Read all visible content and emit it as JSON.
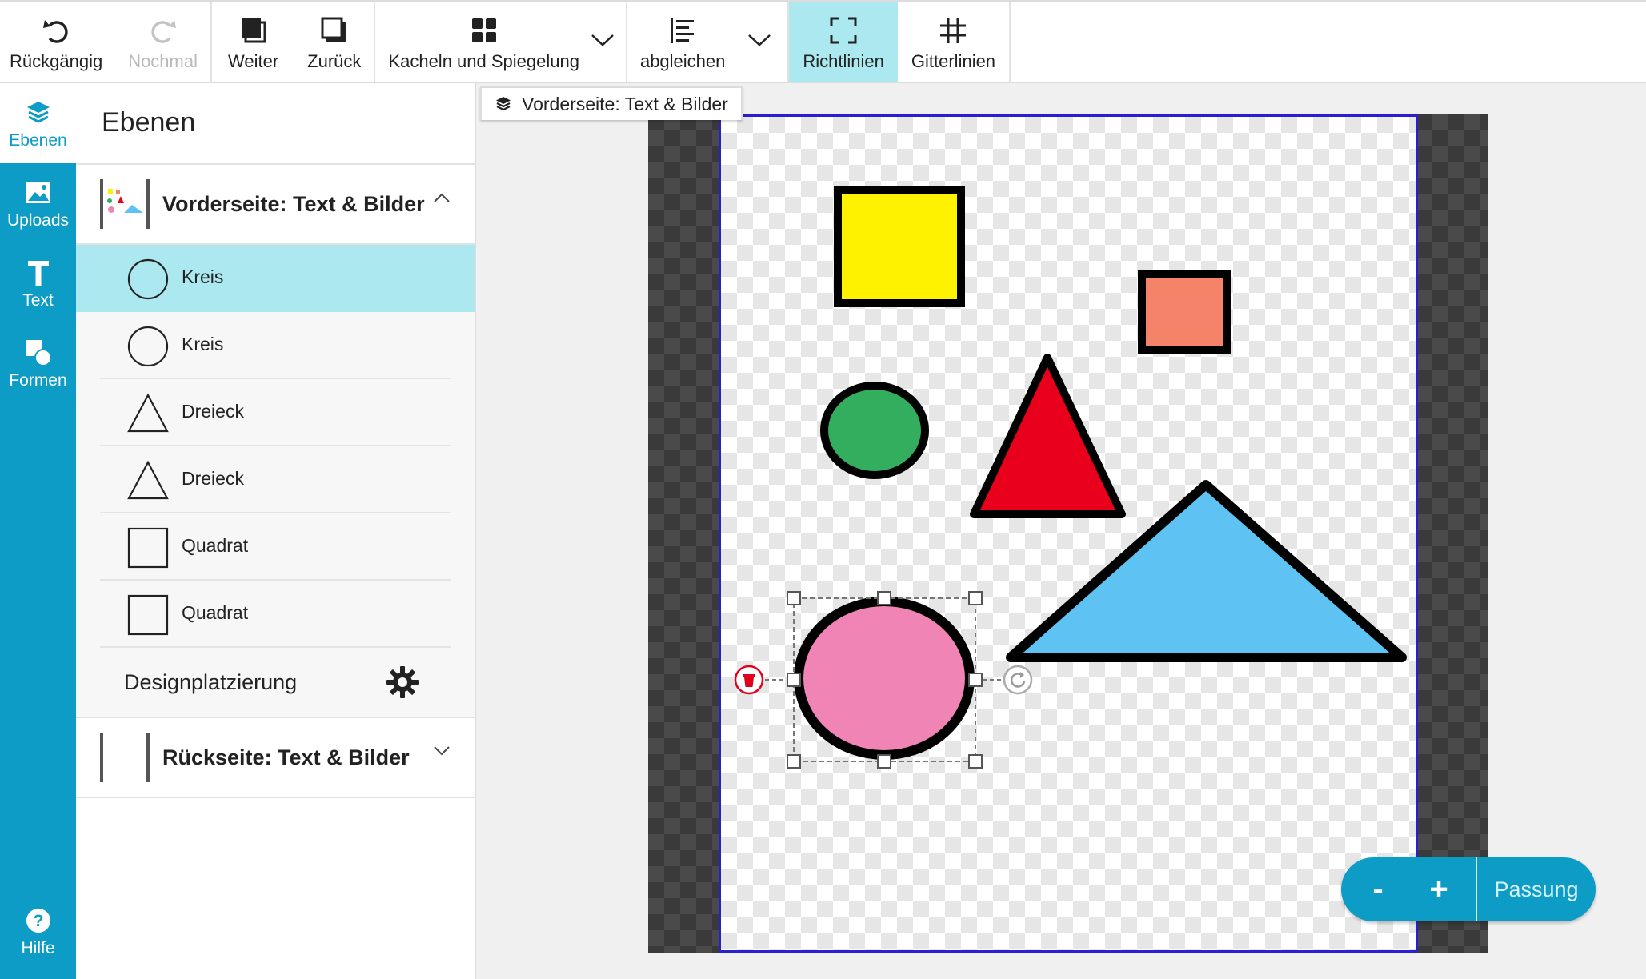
{
  "toolbar": {
    "undo": "Rückgängig",
    "redo": "Nochmal",
    "forward": "Weiter",
    "back": "Zurück",
    "tiles": "Kacheln und Spiegelung",
    "align": "abgleichen",
    "guides": "Richtlinien",
    "grid": "Gitterlinien"
  },
  "nav": {
    "layers": "Ebenen",
    "uploads": "Uploads",
    "text": "Text",
    "shapes": "Formen",
    "help": "Hilfe",
    "active": "layers"
  },
  "panel": {
    "title": "Ebenen",
    "front_group": "Vorderseite: Text & Bilder",
    "back_group": "Rückseite: Text & Bilder",
    "layers": [
      {
        "label": "Kreis",
        "shape": "circle",
        "selected": true
      },
      {
        "label": "Kreis",
        "shape": "circle",
        "selected": false
      },
      {
        "label": "Dreieck",
        "shape": "triangle",
        "selected": false
      },
      {
        "label": "Dreieck",
        "shape": "triangle",
        "selected": false
      },
      {
        "label": "Quadrat",
        "shape": "square",
        "selected": false
      },
      {
        "label": "Quadrat",
        "shape": "square",
        "selected": false
      }
    ],
    "design_placement": "Designplatzierung"
  },
  "canvas": {
    "label": "Vorderseite: Text & Bilder",
    "colors": {
      "yellow_square": "#fff200",
      "salmon_square": "#f4836a",
      "green_circle": "#33ae5f",
      "red_triangle": "#e8001c",
      "blue_triangle": "#5ec3f2",
      "pink_circle": "#f084b4",
      "delete_handle": "#e0001b"
    }
  },
  "zoom": {
    "minus": "-",
    "plus": "+",
    "fit": "Passung"
  },
  "colors": {
    "accent": "#0c9cc5",
    "active_highlight": "#ace8ef"
  }
}
